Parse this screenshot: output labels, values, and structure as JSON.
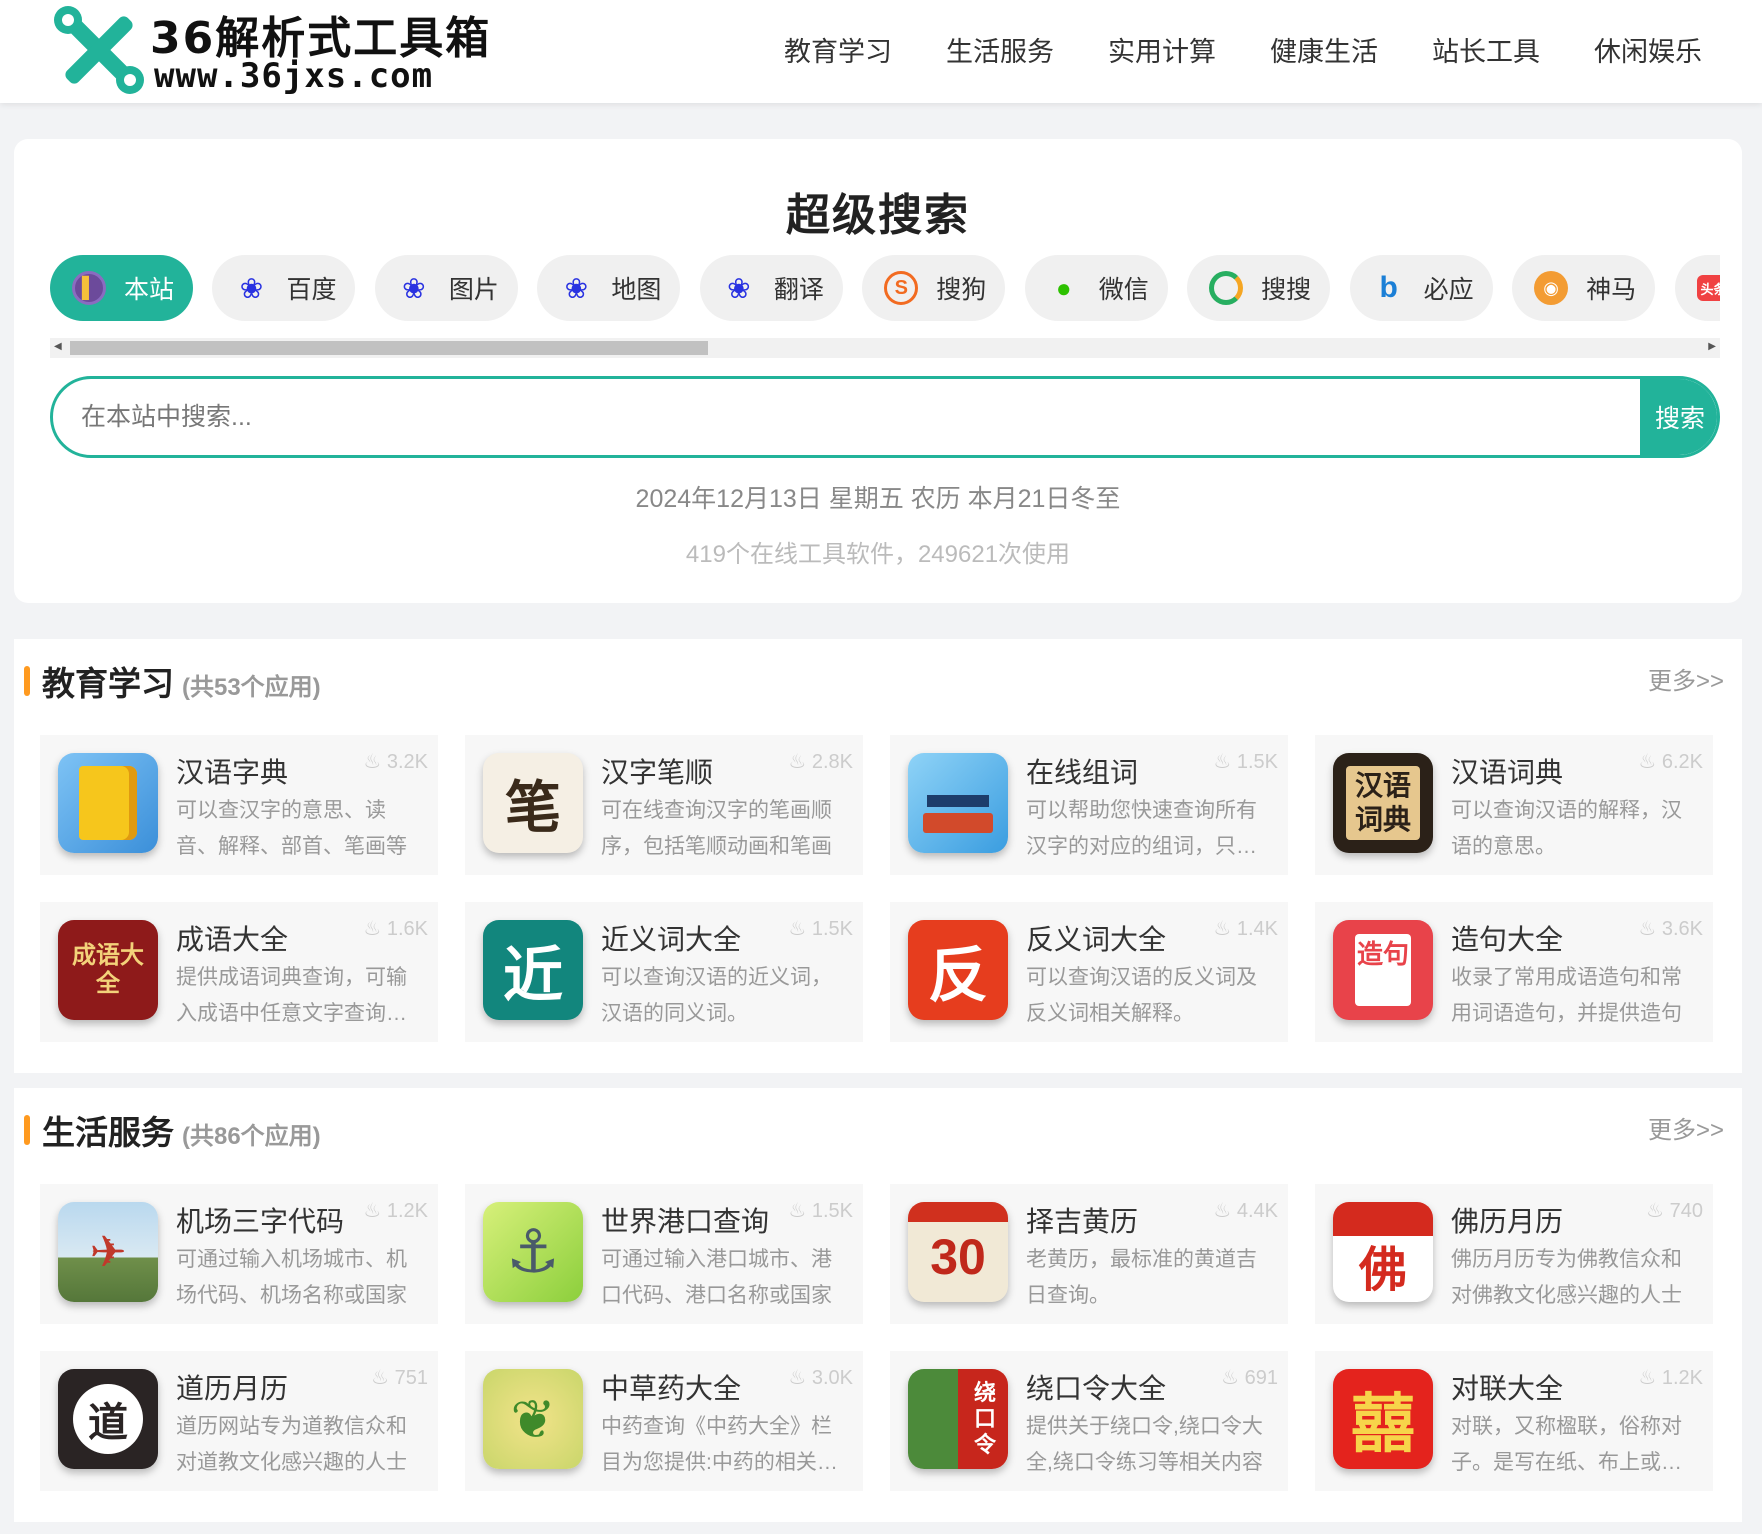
{
  "site": {
    "logo_title": "36解析式工具箱",
    "logo_url": "www.36jxs.com"
  },
  "nav": [
    "教育学习",
    "生活服务",
    "实用计算",
    "健康生活",
    "站长工具",
    "休闲娱乐"
  ],
  "search": {
    "title": "超级搜索",
    "engines": [
      {
        "label": "本站",
        "icon": "site-icon"
      },
      {
        "label": "百度",
        "icon": "baidu-paw-icon"
      },
      {
        "label": "图片",
        "icon": "baidu-paw-icon"
      },
      {
        "label": "地图",
        "icon": "baidu-paw-icon"
      },
      {
        "label": "翻译",
        "icon": "baidu-paw-icon"
      },
      {
        "label": "搜狗",
        "icon": "sogou-icon"
      },
      {
        "label": "微信",
        "icon": "wechat-icon"
      },
      {
        "label": "搜搜",
        "icon": "soso-icon"
      },
      {
        "label": "必应",
        "icon": "bing-icon"
      },
      {
        "label": "神马",
        "icon": "shenma-icon"
      },
      {
        "label": "头条",
        "icon": "toutiao-icon"
      }
    ],
    "placeholder": "在本站中搜索...",
    "button": "搜索",
    "date_line": "2024年12月13日 星期五 农历 本月21日冬至",
    "stats_line": "419个在线工具软件，249621次使用"
  },
  "sections": [
    {
      "title": "教育学习",
      "count": "(共53个应用)",
      "more": "更多>>",
      "apps": [
        {
          "name": "汉语字典",
          "hot": "3.2K",
          "desc": "可以查汉字的意思、读音、解释、部首、笔画等",
          "icon": "dictionary-book-icon"
        },
        {
          "name": "汉字笔顺",
          "hot": "2.8K",
          "desc": "可在线查询汉字的笔画顺序，包括笔顺动画和笔画",
          "icon": "brush-stroke-icon",
          "glyph": "笔"
        },
        {
          "name": "在线组词",
          "hot": "1.5K",
          "desc": "可以帮助您快速查询所有汉字的对应的组词，只需输入",
          "icon": "graduation-cap-book-icon"
        },
        {
          "name": "汉语词典",
          "hot": "6.2K",
          "desc": "可以查询汉语的解释，汉语的意思。",
          "icon": "chinese-dictionary-icon",
          "glyph": "汉语词典"
        },
        {
          "name": "成语大全",
          "hot": "1.6K",
          "desc": "提供成语词典查询，可输入成语中任意文字查询成语",
          "icon": "idiom-book-icon",
          "glyph": "成语大全"
        },
        {
          "name": "近义词大全",
          "hot": "1.5K",
          "desc": "可以查询汉语的近义词，汉语的同义词。",
          "icon": "synonym-icon",
          "glyph": "近"
        },
        {
          "name": "反义词大全",
          "hot": "1.4K",
          "desc": "可以查询汉语的反义词及反义词相关解释。",
          "icon": "antonym-icon",
          "glyph": "反"
        },
        {
          "name": "造句大全",
          "hot": "3.6K",
          "desc": "收录了常用成语造句和常用词语造句，并提供造句",
          "icon": "sentence-icon",
          "glyph": "造句"
        }
      ]
    },
    {
      "title": "生活服务",
      "count": "(共86个应用)",
      "more": "更多>>",
      "apps": [
        {
          "name": "机场三字代码",
          "hot": "1.2K",
          "desc": "可通过输入机场城市、机场代码、机场名称或国家",
          "icon": "airport-plane-icon"
        },
        {
          "name": "世界港口查询",
          "hot": "1.5K",
          "desc": "可通过输入港口城市、港口代码、港口名称或国家",
          "icon": "anchor-icon"
        },
        {
          "name": "择吉黄历",
          "hot": "4.4K",
          "desc": "老黄历，最标准的黄道吉日查询。",
          "icon": "calendar-30-icon",
          "glyph": "30"
        },
        {
          "name": "佛历月历",
          "hot": "740",
          "desc": "佛历月历专为佛教信众和对佛教文化感兴趣的人士",
          "icon": "buddhist-calendar-icon",
          "glyph": "佛"
        },
        {
          "name": "道历月历",
          "hot": "751",
          "desc": "道历网站专为道教信众和对道教文化感兴趣的人士",
          "icon": "taoist-calendar-icon",
          "glyph": "道"
        },
        {
          "name": "中草药大全",
          "hot": "3.0K",
          "desc": "中药查询《中药大全》栏目为您提供:中药的相关信息",
          "icon": "herb-icon"
        },
        {
          "name": "绕口令大全",
          "hot": "691",
          "desc": "提供关于绕口令,绕口令大全,绕口令练习等相关内容",
          "icon": "tongue-twister-icon",
          "glyph": "绕口令"
        },
        {
          "name": "对联大全",
          "hot": "1.2K",
          "desc": "对联，又称楹联，俗称对子。是写在纸、布上或刻在",
          "icon": "couplet-icon",
          "glyph": "囍"
        }
      ]
    }
  ],
  "colors": {
    "accent": "#22b39a",
    "section_bar": "#ff9a1f"
  }
}
